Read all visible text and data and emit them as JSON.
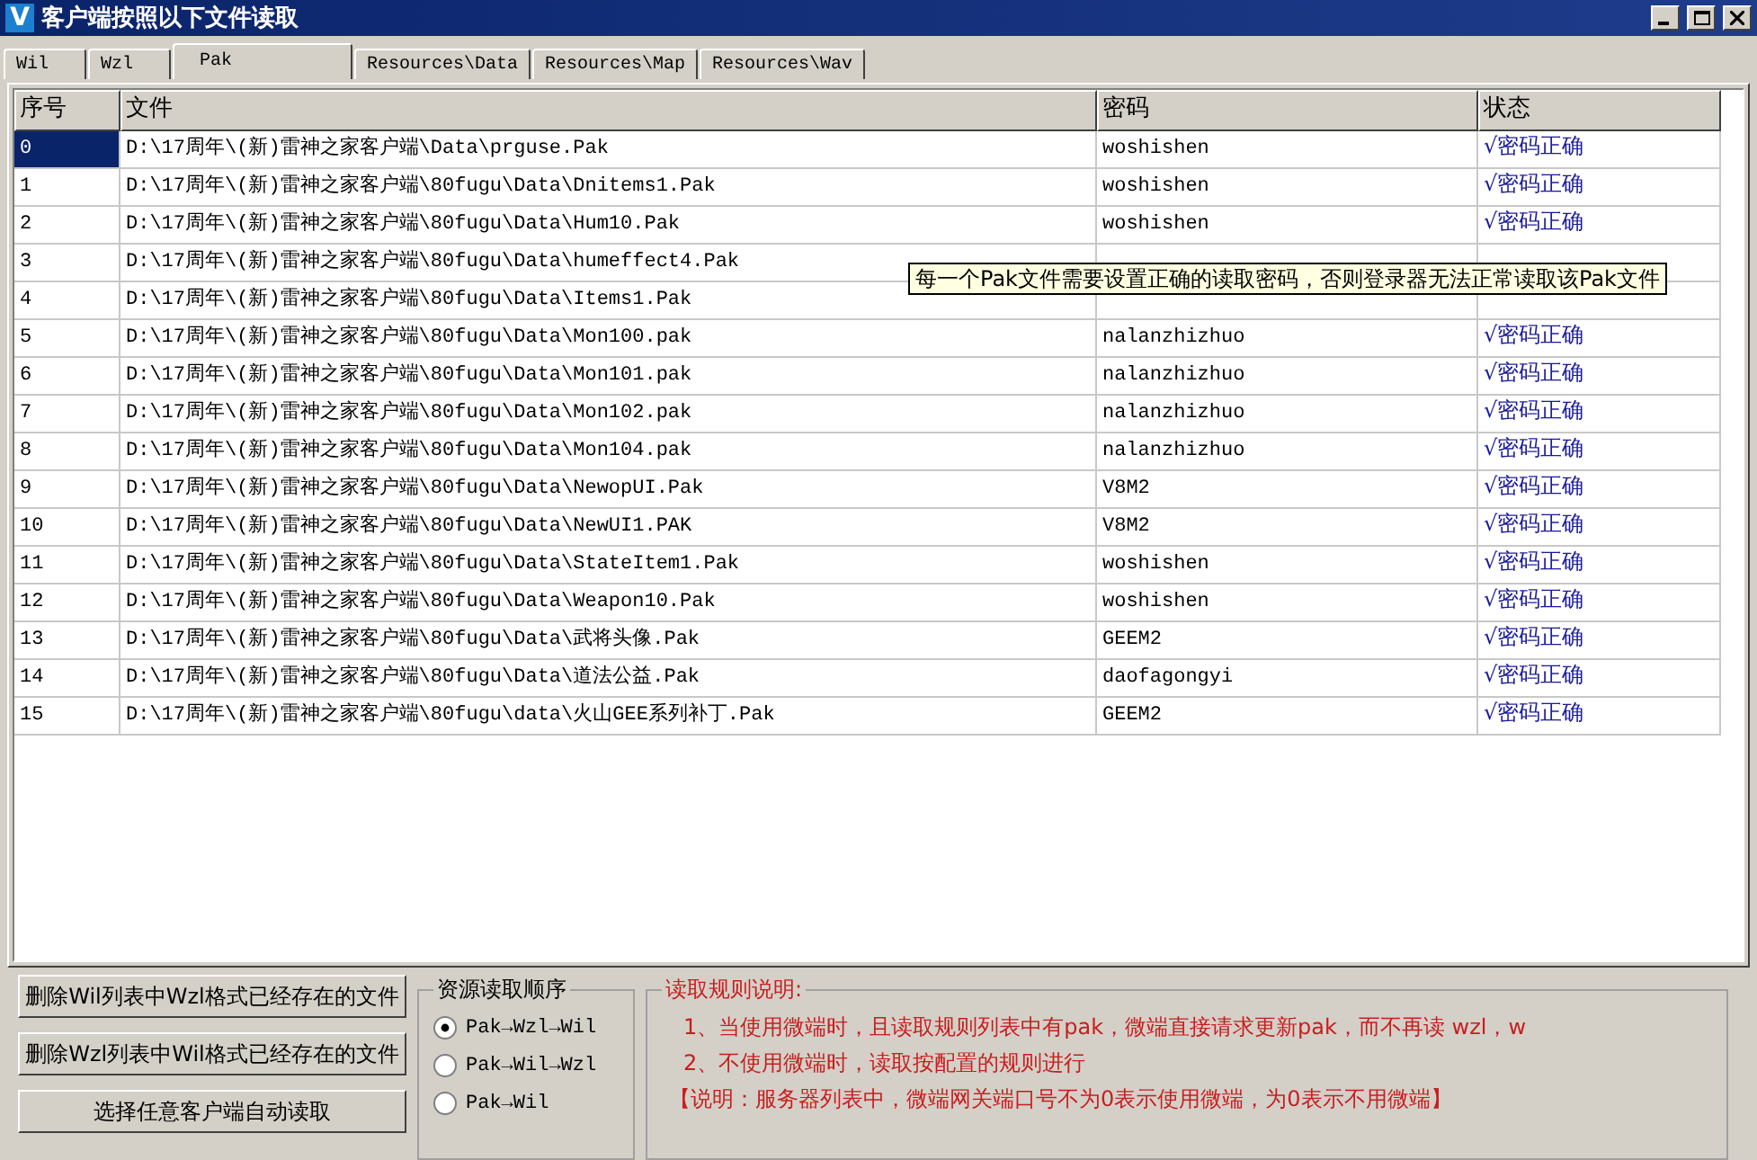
{
  "window": {
    "icon": "V",
    "title": "客户端按照以下文件读取"
  },
  "tabs": [
    {
      "label": "Wil",
      "selected": false
    },
    {
      "label": "Wzl",
      "selected": false
    },
    {
      "label": "Pak",
      "selected": true
    },
    {
      "label": "Resources\\Data",
      "selected": false
    },
    {
      "label": "Resources\\Map",
      "selected": false
    },
    {
      "label": "Resources\\Wav",
      "selected": false
    }
  ],
  "table": {
    "columns": [
      "序号",
      "文件",
      "密码",
      "状态"
    ],
    "rows": [
      {
        "index": "0",
        "file": "D:\\17周年\\(新)雷神之家客户端\\Data\\prguse.Pak",
        "password": "woshishen",
        "status": "√密码正确",
        "selected": true
      },
      {
        "index": "1",
        "file": "D:\\17周年\\(新)雷神之家客户端\\80fugu\\Data\\Dnitems1.Pak",
        "password": "woshishen",
        "status": "√密码正确",
        "selected": false
      },
      {
        "index": "2",
        "file": "D:\\17周年\\(新)雷神之家客户端\\80fugu\\Data\\Hum10.Pak",
        "password": "woshishen",
        "status": "√密码正确",
        "selected": false
      },
      {
        "index": "3",
        "file": "D:\\17周年\\(新)雷神之家客户端\\80fugu\\Data\\humeffect4.Pak",
        "selected": false
      },
      {
        "index": "4",
        "file": "D:\\17周年\\(新)雷神之家客户端\\80fugu\\Data\\Items1.Pak",
        "selected": false
      },
      {
        "index": "5",
        "file": "D:\\17周年\\(新)雷神之家客户端\\80fugu\\Data\\Mon100.pak",
        "password": "nalanzhizhuo",
        "status": "√密码正确",
        "selected": false
      },
      {
        "index": "6",
        "file": "D:\\17周年\\(新)雷神之家客户端\\80fugu\\Data\\Mon101.pak",
        "password": "nalanzhizhuo",
        "status": "√密码正确",
        "selected": false
      },
      {
        "index": "7",
        "file": "D:\\17周年\\(新)雷神之家客户端\\80fugu\\Data\\Mon102.pak",
        "password": "nalanzhizhuo",
        "status": "√密码正确",
        "selected": false
      },
      {
        "index": "8",
        "file": "D:\\17周年\\(新)雷神之家客户端\\80fugu\\Data\\Mon104.pak",
        "password": "nalanzhizhuo",
        "status": "√密码正确",
        "selected": false
      },
      {
        "index": "9",
        "file": "D:\\17周年\\(新)雷神之家客户端\\80fugu\\Data\\NewopUI.Pak",
        "password": "V8M2",
        "status": "√密码正确",
        "selected": false
      },
      {
        "index": "10",
        "file": "D:\\17周年\\(新)雷神之家客户端\\80fugu\\Data\\NewUI1.PAK",
        "password": "V8M2",
        "status": "√密码正确",
        "selected": false
      },
      {
        "index": "11",
        "file": "D:\\17周年\\(新)雷神之家客户端\\80fugu\\Data\\StateItem1.Pak",
        "password": "woshishen",
        "status": "√密码正确",
        "selected": false
      },
      {
        "index": "12",
        "file": "D:\\17周年\\(新)雷神之家客户端\\80fugu\\Data\\Weapon10.Pak",
        "password": "woshishen",
        "status": "√密码正确",
        "selected": false
      },
      {
        "index": "13",
        "file": "D:\\17周年\\(新)雷神之家客户端\\80fugu\\Data\\武将头像.Pak",
        "password": "GEEM2",
        "status": "√密码正确",
        "selected": false
      },
      {
        "index": "14",
        "file": "D:\\17周年\\(新)雷神之家客户端\\80fugu\\Data\\道法公益.Pak",
        "password": "daofagongyi",
        "status": "√密码正确",
        "selected": false
      },
      {
        "index": "15",
        "file": "D:\\17周年\\(新)雷神之家客户端\\80fugu\\data\\火山GEE系列补丁.Pak",
        "password": "GEEM2",
        "status": "√密码正确",
        "selected": false
      }
    ]
  },
  "tooltip": "每一个Pak文件需要设置正确的读取密码，否则登录器无法正常读取该Pak文件",
  "buttons": [
    "删除Wil列表中Wzl格式已经存在的文件",
    "删除Wzl列表中Wil格式已经存在的文件",
    "选择任意客户端自动读取"
  ],
  "order_group": {
    "title": "资源读取顺序",
    "options": [
      {
        "label": "Pak→Wzl→Wil",
        "selected": true
      },
      {
        "label": "Pak→Wil→Wzl",
        "selected": false
      },
      {
        "label": "Pak→Wil",
        "selected": false
      }
    ]
  },
  "rules_group": {
    "title": "读取规则说明:",
    "lines": [
      "1、当使用微端时，且读取规则列表中有pak，微端直接请求更新pak，而不再读 wzl，w",
      "2、不使用微端时，读取按配置的规则进行",
      "【说明：服务器列表中，微端网关端口号不为0表示使用微端，为0表示不用微端】"
    ]
  }
}
